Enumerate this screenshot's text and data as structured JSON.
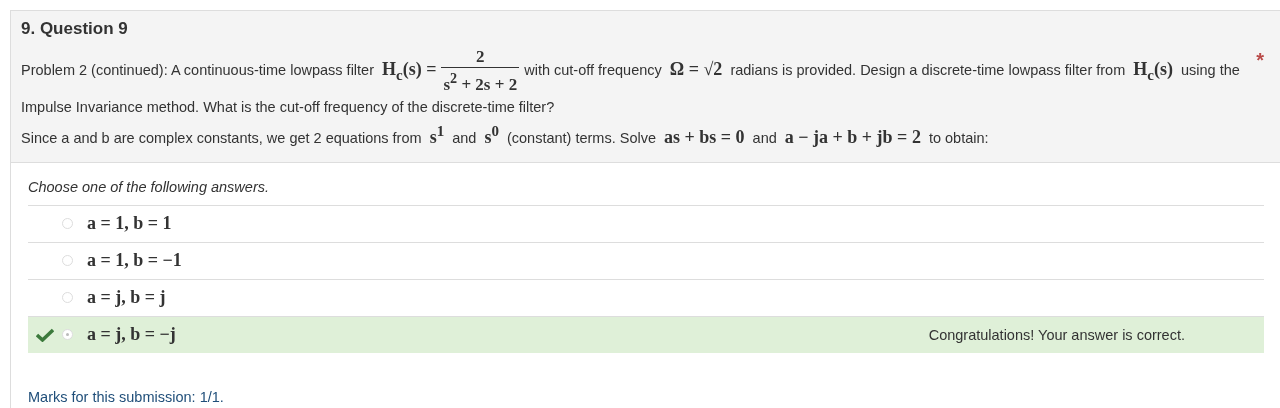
{
  "question": {
    "title": "9. Question 9",
    "required_mark": "*",
    "problem": [
      {
        "kind": "text",
        "text": "Problem 2 (continued): A continuous-time lowpass filter "
      },
      {
        "kind": "math",
        "text": "H$_{c}$(s) ="
      },
      {
        "kind": "fraction",
        "numerator": "2",
        "denominator": "s$^{2}$ + 2s + 2"
      },
      {
        "kind": "text",
        "text": " with cut-off frequency "
      },
      {
        "kind": "math",
        "text": "Ω = √2"
      },
      {
        "kind": "text",
        "text": " radians is provided. Design a discrete-time lowpass filter from "
      },
      {
        "kind": "math",
        "text": "H$_{c}$(s)"
      },
      {
        "kind": "text",
        "text": " using the Impulse Invariance method. What is the cut-off frequency of the discrete-time filter?"
      }
    ],
    "hint": [
      {
        "kind": "text",
        "text": "Since a and b are complex constants, we get 2 equations from "
      },
      {
        "kind": "math",
        "text": "s$^{1}$"
      },
      {
        "kind": "text",
        "text": " and "
      },
      {
        "kind": "math",
        "text": "s$^{0}$"
      },
      {
        "kind": "text",
        "text": " (constant) terms. Solve "
      },
      {
        "kind": "math",
        "text": "as + bs = 0"
      },
      {
        "kind": "text",
        "text": " and "
      },
      {
        "kind": "math",
        "text": "a − ja + b + jb = 2"
      },
      {
        "kind": "text",
        "text": " to obtain:"
      }
    ]
  },
  "answers": {
    "prompt": "Choose one of the following answers.",
    "options": [
      {
        "label": "a = 1, b = 1",
        "selected": false
      },
      {
        "label": "a = 1, b = −1",
        "selected": false
      },
      {
        "label": "a = j, b = j",
        "selected": false
      },
      {
        "label": "a = j, b = −j",
        "selected": true,
        "feedback": "Congratulations! Your answer is correct."
      }
    ]
  },
  "marks": "Marks for this submission: 1/1."
}
